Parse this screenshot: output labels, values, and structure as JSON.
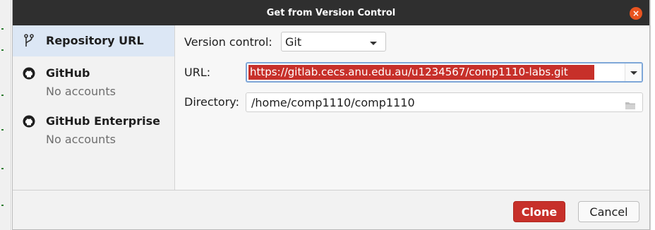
{
  "dialog": {
    "title": "Get from Version Control"
  },
  "sidebar": {
    "items": [
      {
        "label": "Repository URL",
        "icon": "vcs-branch-icon"
      },
      {
        "label": "GitHub",
        "sub": "No accounts",
        "icon": "github-icon"
      },
      {
        "label": "GitHub Enterprise",
        "sub": "No accounts",
        "icon": "github-icon"
      }
    ]
  },
  "form": {
    "vcs_label": "Version control:",
    "vcs_value": "Git",
    "url_label": "URL:",
    "url_value": "https://gitlab.cecs.anu.edu.au/u1234567/comp1110-labs.git",
    "dir_label": "Directory:",
    "dir_value": "/home/comp1110/comp1110"
  },
  "footer": {
    "clone_label": "Clone",
    "cancel_label": "Cancel"
  },
  "colors": {
    "accent": "#c7302a",
    "titlebar": "#2f2f2f",
    "close": "#e95420",
    "selection": "#dce7f5"
  }
}
